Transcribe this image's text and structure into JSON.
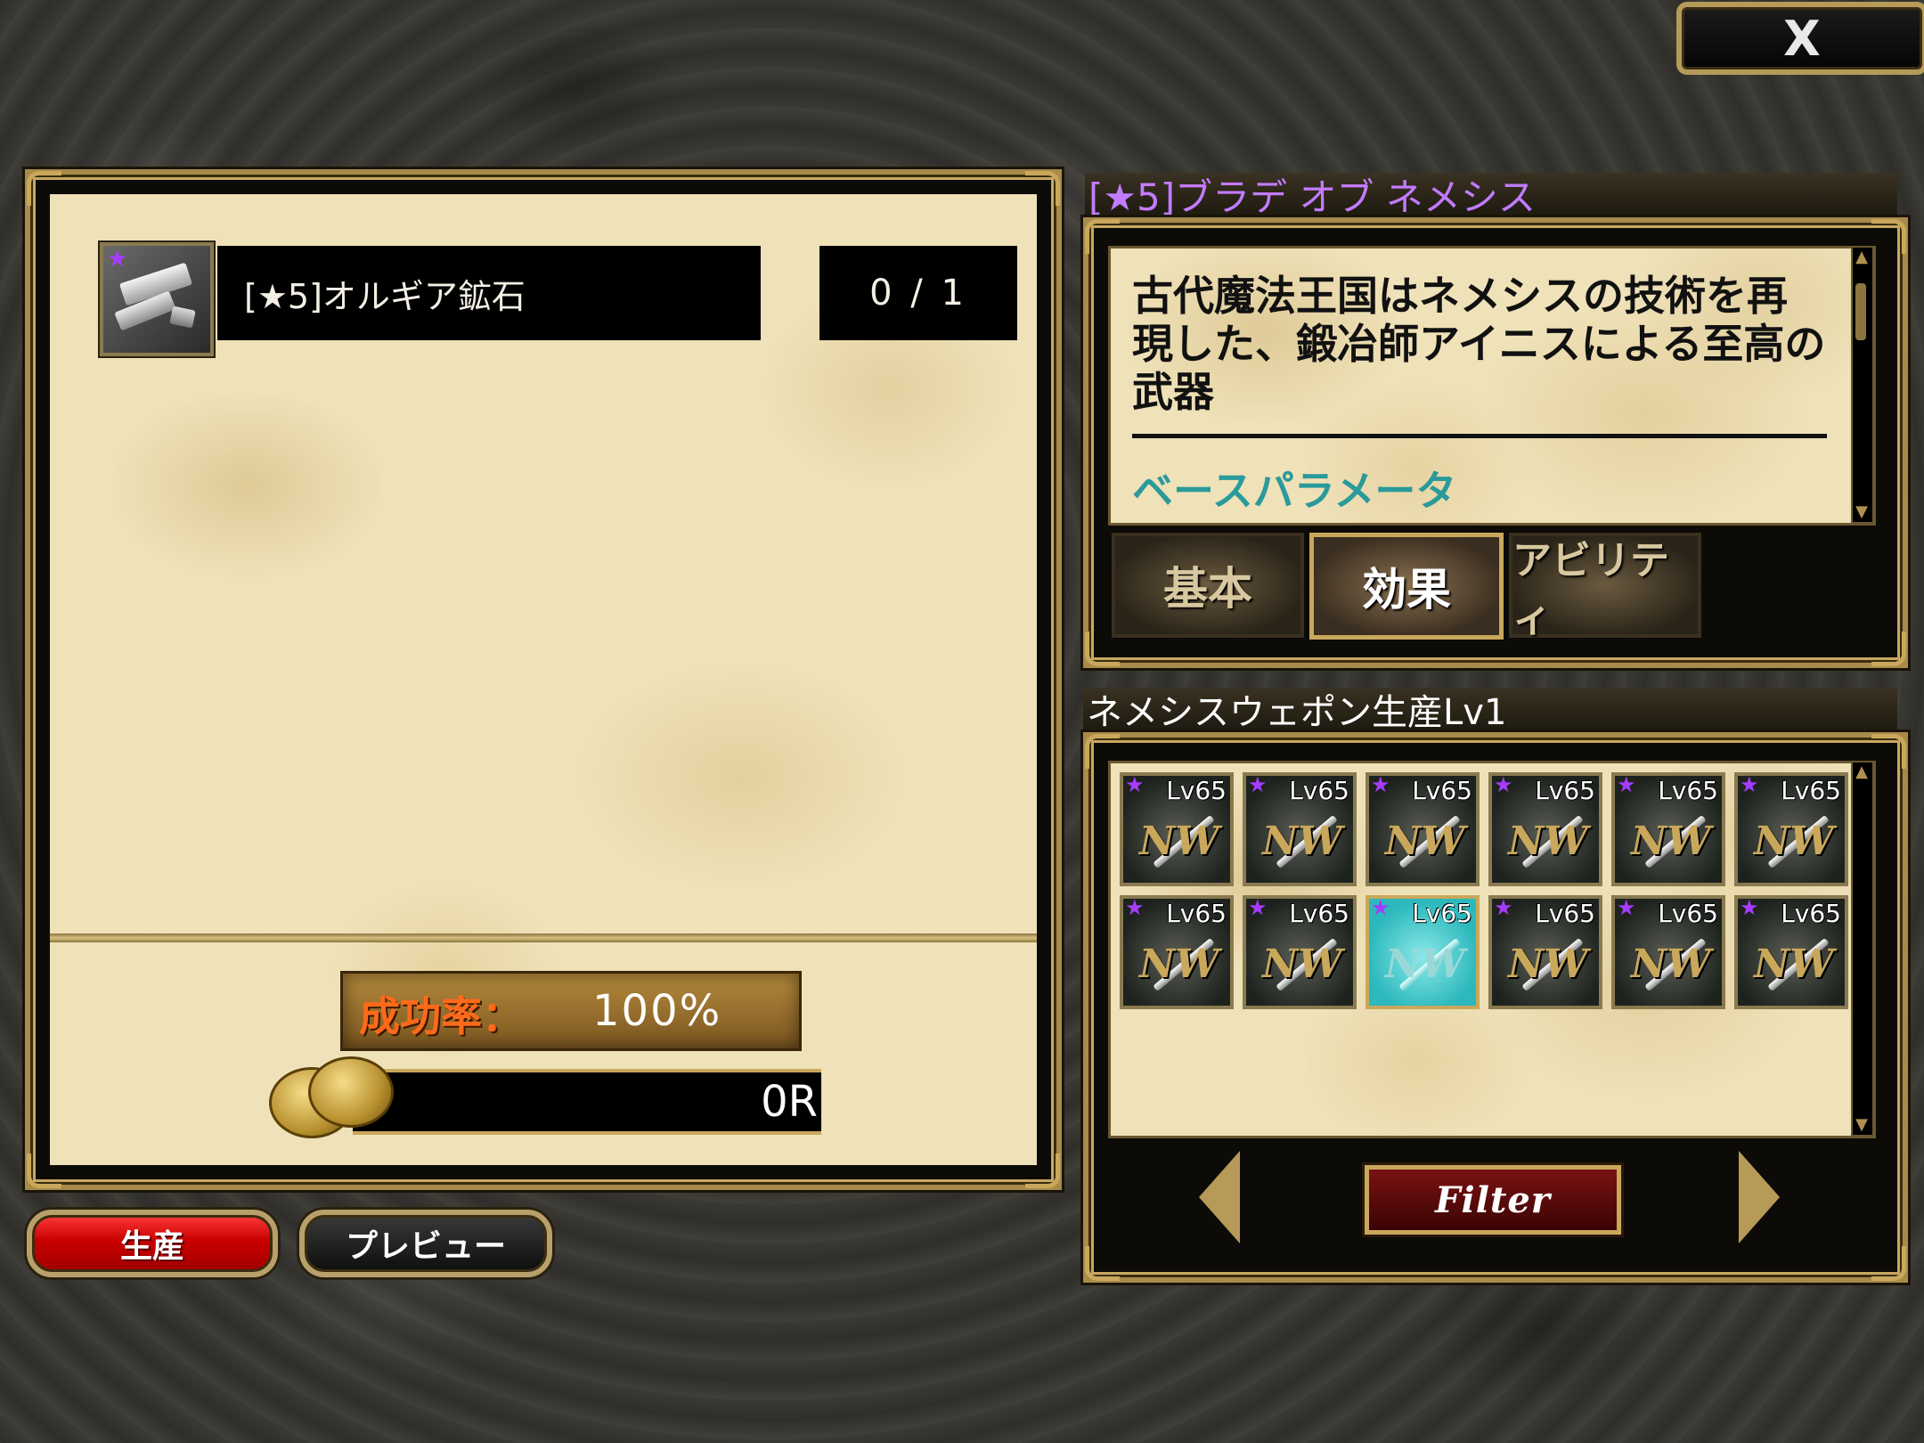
{
  "close_button": {
    "label": "X"
  },
  "material": {
    "name": "[★5]オルギア鉱石",
    "count": "0 / 1",
    "icon": "ore-icon"
  },
  "success_rate": {
    "label": "成功率：",
    "value": "100%"
  },
  "cost": {
    "value": "0R",
    "icon": "coin-icon"
  },
  "buttons": {
    "produce": "生産",
    "preview": "プレビュー"
  },
  "item_detail": {
    "title": "[★5]ブラデ オブ ネメシス",
    "description": "古代魔法王国はネメシスの技術を再現した、鍛冶師アイニスによる至高の武器",
    "section_heading": "ベースパラメータ",
    "tabs": [
      {
        "label": "基本",
        "active": false
      },
      {
        "label": "効果",
        "active": true
      },
      {
        "label": "アビリティ",
        "active": false
      }
    ]
  },
  "recipe_list": {
    "title": "ネメシスウェポン生産Lv1",
    "items": [
      {
        "level": "Lv65",
        "badge": "NW",
        "selected": false
      },
      {
        "level": "Lv65",
        "badge": "NW",
        "selected": false
      },
      {
        "level": "Lv65",
        "badge": "NW",
        "selected": false
      },
      {
        "level": "Lv65",
        "badge": "NW",
        "selected": false
      },
      {
        "level": "Lv65",
        "badge": "NW",
        "selected": false
      },
      {
        "level": "Lv65",
        "badge": "NW",
        "selected": false
      },
      {
        "level": "Lv65",
        "badge": "NW",
        "selected": false
      },
      {
        "level": "Lv65",
        "badge": "NW",
        "selected": false
      },
      {
        "level": "Lv65",
        "badge": "NW",
        "selected": true
      },
      {
        "level": "Lv65",
        "badge": "NW",
        "selected": false
      },
      {
        "level": "Lv65",
        "badge": "NW",
        "selected": false
      },
      {
        "level": "Lv65",
        "badge": "NW",
        "selected": false
      }
    ],
    "filter_label": "Filter"
  },
  "colors": {
    "rarity_star": "#a63cff",
    "title_purple": "#c27bff",
    "param_teal": "#2a9a9a",
    "success_orange": "#ff6a1a",
    "produce_red": "#c80000",
    "gold_frame": "#c9a85c"
  }
}
